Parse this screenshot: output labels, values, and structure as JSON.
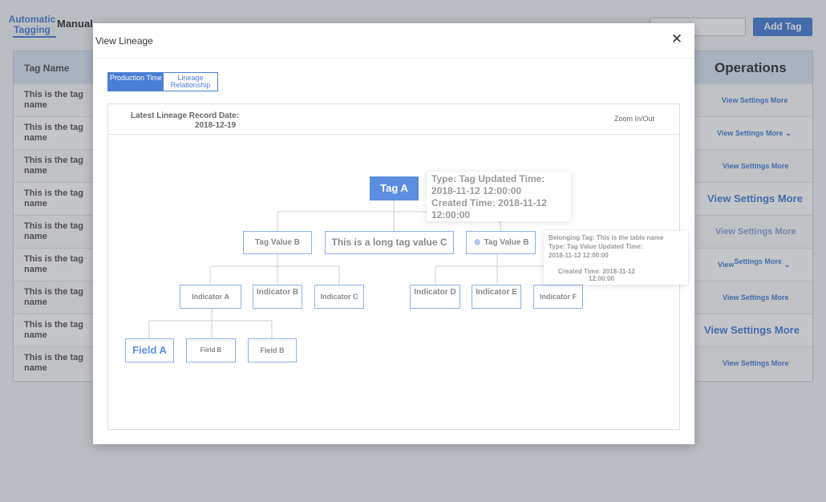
{
  "tabs": {
    "automatic": "Automatic Tagging",
    "manual": "Manual"
  },
  "search": {
    "placeholder": ""
  },
  "add_tag_label": "Add Tag",
  "table": {
    "headers": {
      "tag_name": "Tag Name",
      "operations": "Operations"
    },
    "rows": [
      {
        "name": "This is the tag name",
        "ops": "View Settings More"
      },
      {
        "name": "This is the tag name",
        "ops": "View Settings More"
      },
      {
        "name": "This is the tag name",
        "ops": "View Settings More"
      },
      {
        "name": "This is the tag name",
        "ops": "View Settings More"
      },
      {
        "name": "This is the tag name",
        "ops": "View Settings More"
      },
      {
        "name": "This is the tag name",
        "ops_a": "View",
        "ops_b": "Settings More"
      },
      {
        "name": "This is the tag name",
        "ops": "View Settings More"
      },
      {
        "name": "This is the tag name",
        "ops": "View Settings More"
      },
      {
        "name": "This is the tag name",
        "ops": "View Settings More"
      }
    ]
  },
  "modal": {
    "title": "View Lineage",
    "close_icon": "close-icon",
    "tabs": [
      "Production Time",
      "Lineage Relationship"
    ],
    "latest_record_label": "Latest Lineage Record Date:",
    "latest_record_date": "2018-12-19",
    "zoom_label": "Zoom In/Out"
  },
  "lineage": {
    "root": "Tag A",
    "level1": [
      "Tag Value B",
      "This is a long tag value C",
      "Tag Value B"
    ],
    "level2": [
      "Indicator A",
      "Indicator B",
      "Indicator C",
      "Indicator D",
      "Indicator E",
      "Indicator F"
    ],
    "level3": [
      "Field A",
      "Field B",
      "Field B"
    ],
    "tooltip_root": [
      "Type: Tag Updated Time:",
      "2018-11-12 12:00:00",
      "Created Time: 2018-11-12",
      "12:00:00"
    ],
    "tooltip_node": [
      "Belonging Tag: This is the table name",
      "Type: Tag Value Updated Time:",
      "2018-11-12 12:00:00",
      "Created Time: 2018-11-12",
      "12:00:00"
    ]
  },
  "colors": {
    "accent": "#4a7fd6",
    "root_node": "#5b8ee0",
    "node_border": "#8fb0e4"
  }
}
